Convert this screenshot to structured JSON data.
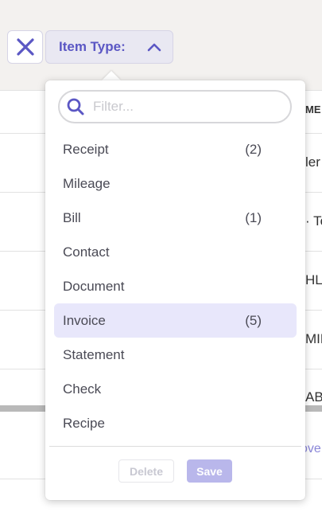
{
  "background": {
    "column_header": "ME",
    "rows": [
      "ler",
      "· To",
      "HL'",
      "MIL",
      "AB"
    ],
    "link_text": "ove"
  },
  "filter": {
    "close_icon": "close-icon",
    "chip_label": "Item Type:",
    "chevron_icon": "chevron-up-icon",
    "accent_color": "#5b57c4"
  },
  "popover": {
    "search": {
      "placeholder": "Filter...",
      "value": "",
      "icon": "search-icon"
    },
    "items": [
      {
        "label": "Receipt",
        "count": "(2)"
      },
      {
        "label": "Mileage",
        "count": ""
      },
      {
        "label": "Bill",
        "count": "(1)"
      },
      {
        "label": "Contact",
        "count": ""
      },
      {
        "label": "Document",
        "count": ""
      },
      {
        "label": "Invoice",
        "count": "(5)",
        "selected": true
      },
      {
        "label": "Statement",
        "count": ""
      },
      {
        "label": "Check",
        "count": ""
      },
      {
        "label": "Recipe",
        "count": ""
      }
    ],
    "buttons": {
      "delete_label": "Delete",
      "save_label": "Save"
    }
  }
}
